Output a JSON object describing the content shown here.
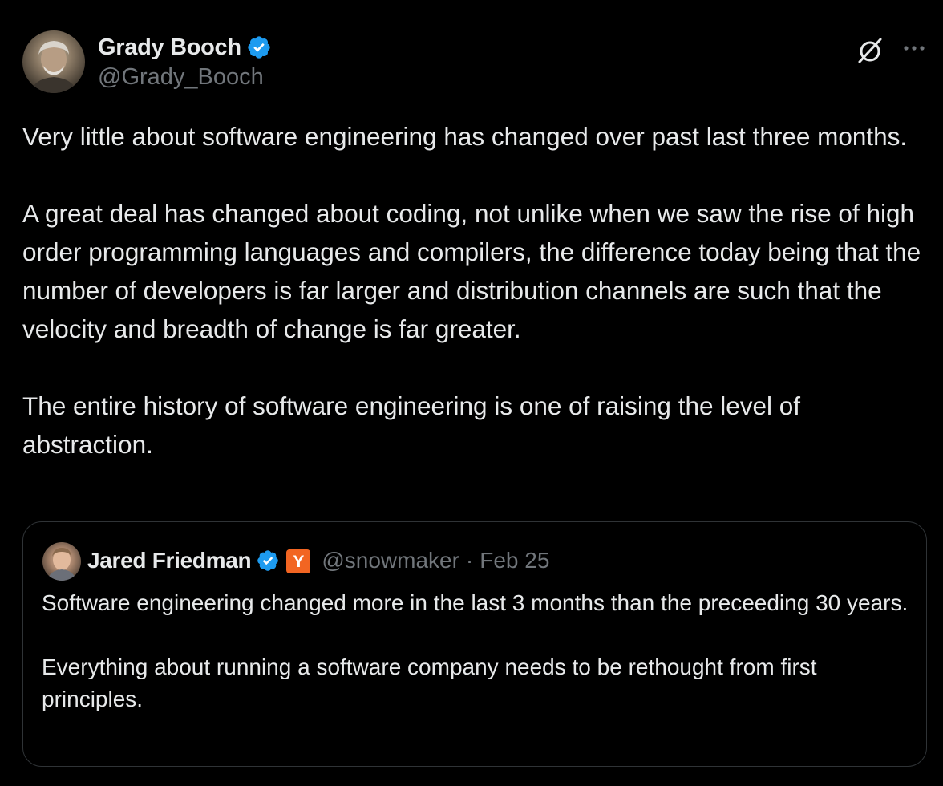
{
  "author": {
    "display_name": "Grady Booch",
    "handle": "@Grady_Booch",
    "verified": true,
    "avatar_icon": "avatar-photo"
  },
  "actions": {
    "grok_icon": "grok-icon",
    "more_icon": "more-icon"
  },
  "tweet": {
    "paragraphs": [
      "Very little about software engineering has changed over past last three months.",
      "A great deal has changed about coding, not unlike when we saw the rise of high order programming languages and compilers, the difference today being that the number of developers is far larger and distribution channels are such that the velocity and breadth of change is far greater.",
      "The entire history of software engineering is one of raising the level of abstraction."
    ]
  },
  "quote": {
    "display_name": "Jared Friedman",
    "handle": "@snowmaker",
    "separator": "·",
    "date": "Feb 25",
    "verified": true,
    "affiliate_badge": "Y",
    "paragraphs": [
      "Software engineering changed more in the last 3 months than the preceeding 30 years.",
      "Everything about running a software company needs to be rethought from first principles."
    ]
  },
  "colors": {
    "background": "#000000",
    "text": "#e7e9ea",
    "muted": "#71767b",
    "verified_blue": "#1d9bf0",
    "border": "#2f3336",
    "yc_orange": "#f26522"
  }
}
